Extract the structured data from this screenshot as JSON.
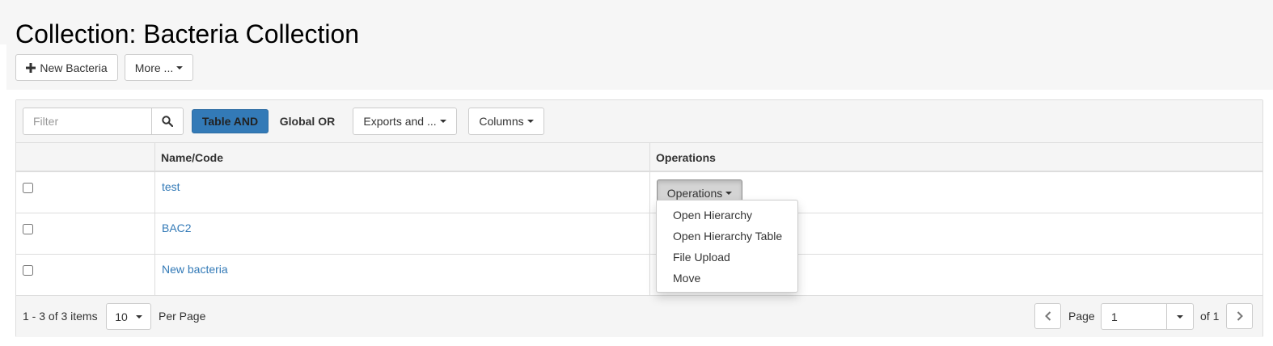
{
  "page": {
    "title": "Collection: Bacteria Collection"
  },
  "actions": {
    "new_label": "New Bacteria",
    "more_label": "More ..."
  },
  "toolbar": {
    "filter_placeholder": "Filter",
    "table_and_label": "Table AND",
    "global_or_label": "Global OR",
    "exports_label": "Exports and ...",
    "columns_label": "Columns"
  },
  "table": {
    "columns": [
      "",
      "Name/Code",
      "Operations"
    ],
    "rows": [
      {
        "name": "test",
        "operations_label": "Operations"
      },
      {
        "name": "BAC2"
      },
      {
        "name": "New bacteria"
      }
    ]
  },
  "dropdown": {
    "items": [
      "Open Hierarchy",
      "Open Hierarchy Table",
      "File Upload",
      "Move"
    ]
  },
  "footer": {
    "range_label": "1 - 3 of 3 items",
    "page_size": "10",
    "per_page_label": "Per Page",
    "page_label": "Page",
    "page_value": "1",
    "of_label": "of 1"
  },
  "colors": {
    "accent": "#337ab7",
    "link": "#337ab7"
  }
}
